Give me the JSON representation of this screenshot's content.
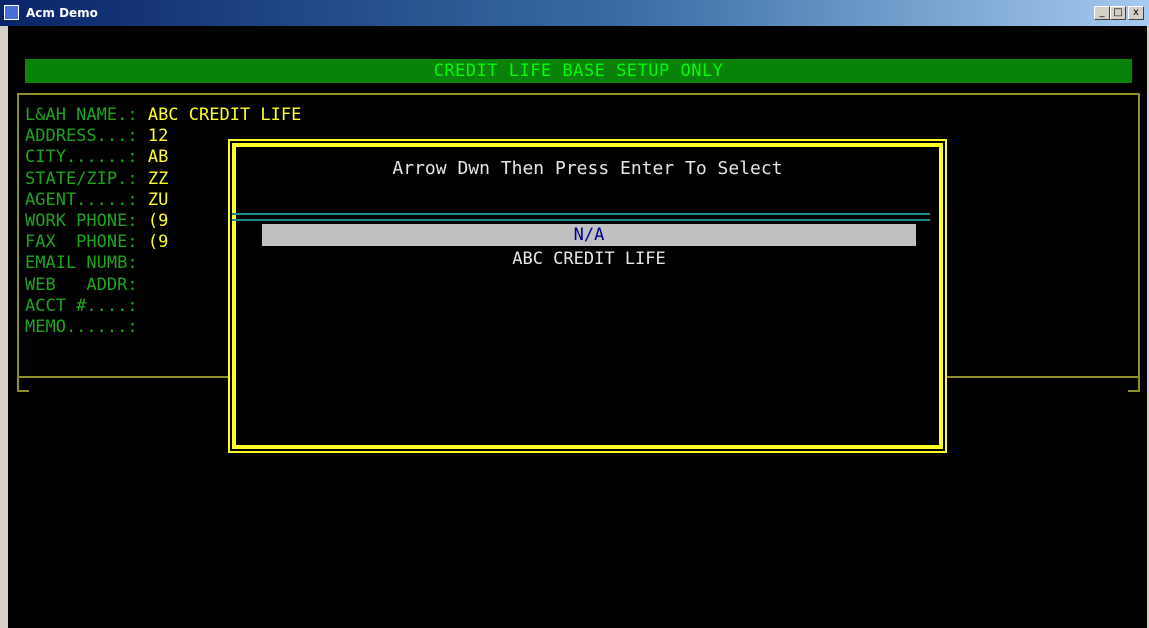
{
  "window": {
    "title": "Acm Demo",
    "buttons": {
      "minimize": "_",
      "maximize": "□",
      "close": "x"
    }
  },
  "banner": "CREDIT LIFE BASE SETUP ONLY",
  "fields": [
    {
      "label": "L&AH NAME.: ",
      "value": "ABC CREDIT LIFE"
    },
    {
      "label": "ADDRESS...: ",
      "value": "12"
    },
    {
      "label": "CITY......: ",
      "value": "AB"
    },
    {
      "label": "STATE/ZIP.: ",
      "value": "ZZ"
    },
    {
      "label": "AGENT.....: ",
      "value": "ZU"
    },
    {
      "label": "WORK PHONE: ",
      "value": "(9"
    },
    {
      "label": "FAX  PHONE: ",
      "value": "(9"
    },
    {
      "label": "EMAIL NUMB:",
      "value": ""
    },
    {
      "label": "WEB   ADDR:",
      "value": ""
    },
    {
      "label": "ACCT #....:",
      "value": ""
    },
    {
      "label": "MEMO......:",
      "value": ""
    }
  ],
  "dialog": {
    "title": "Arrow Dwn Then Press Enter To Select",
    "items": [
      {
        "label": "N/A",
        "selected": true
      },
      {
        "label": "ABC CREDIT LIFE",
        "selected": false
      }
    ]
  },
  "colors": {
    "label_green": "#1ea51e",
    "value_yellow": "#ffff24",
    "banner_bg": "#088208",
    "frame_olive": "#8f8f2a",
    "selection_bg": "#c0c0c0",
    "selection_fg": "#00008b"
  }
}
